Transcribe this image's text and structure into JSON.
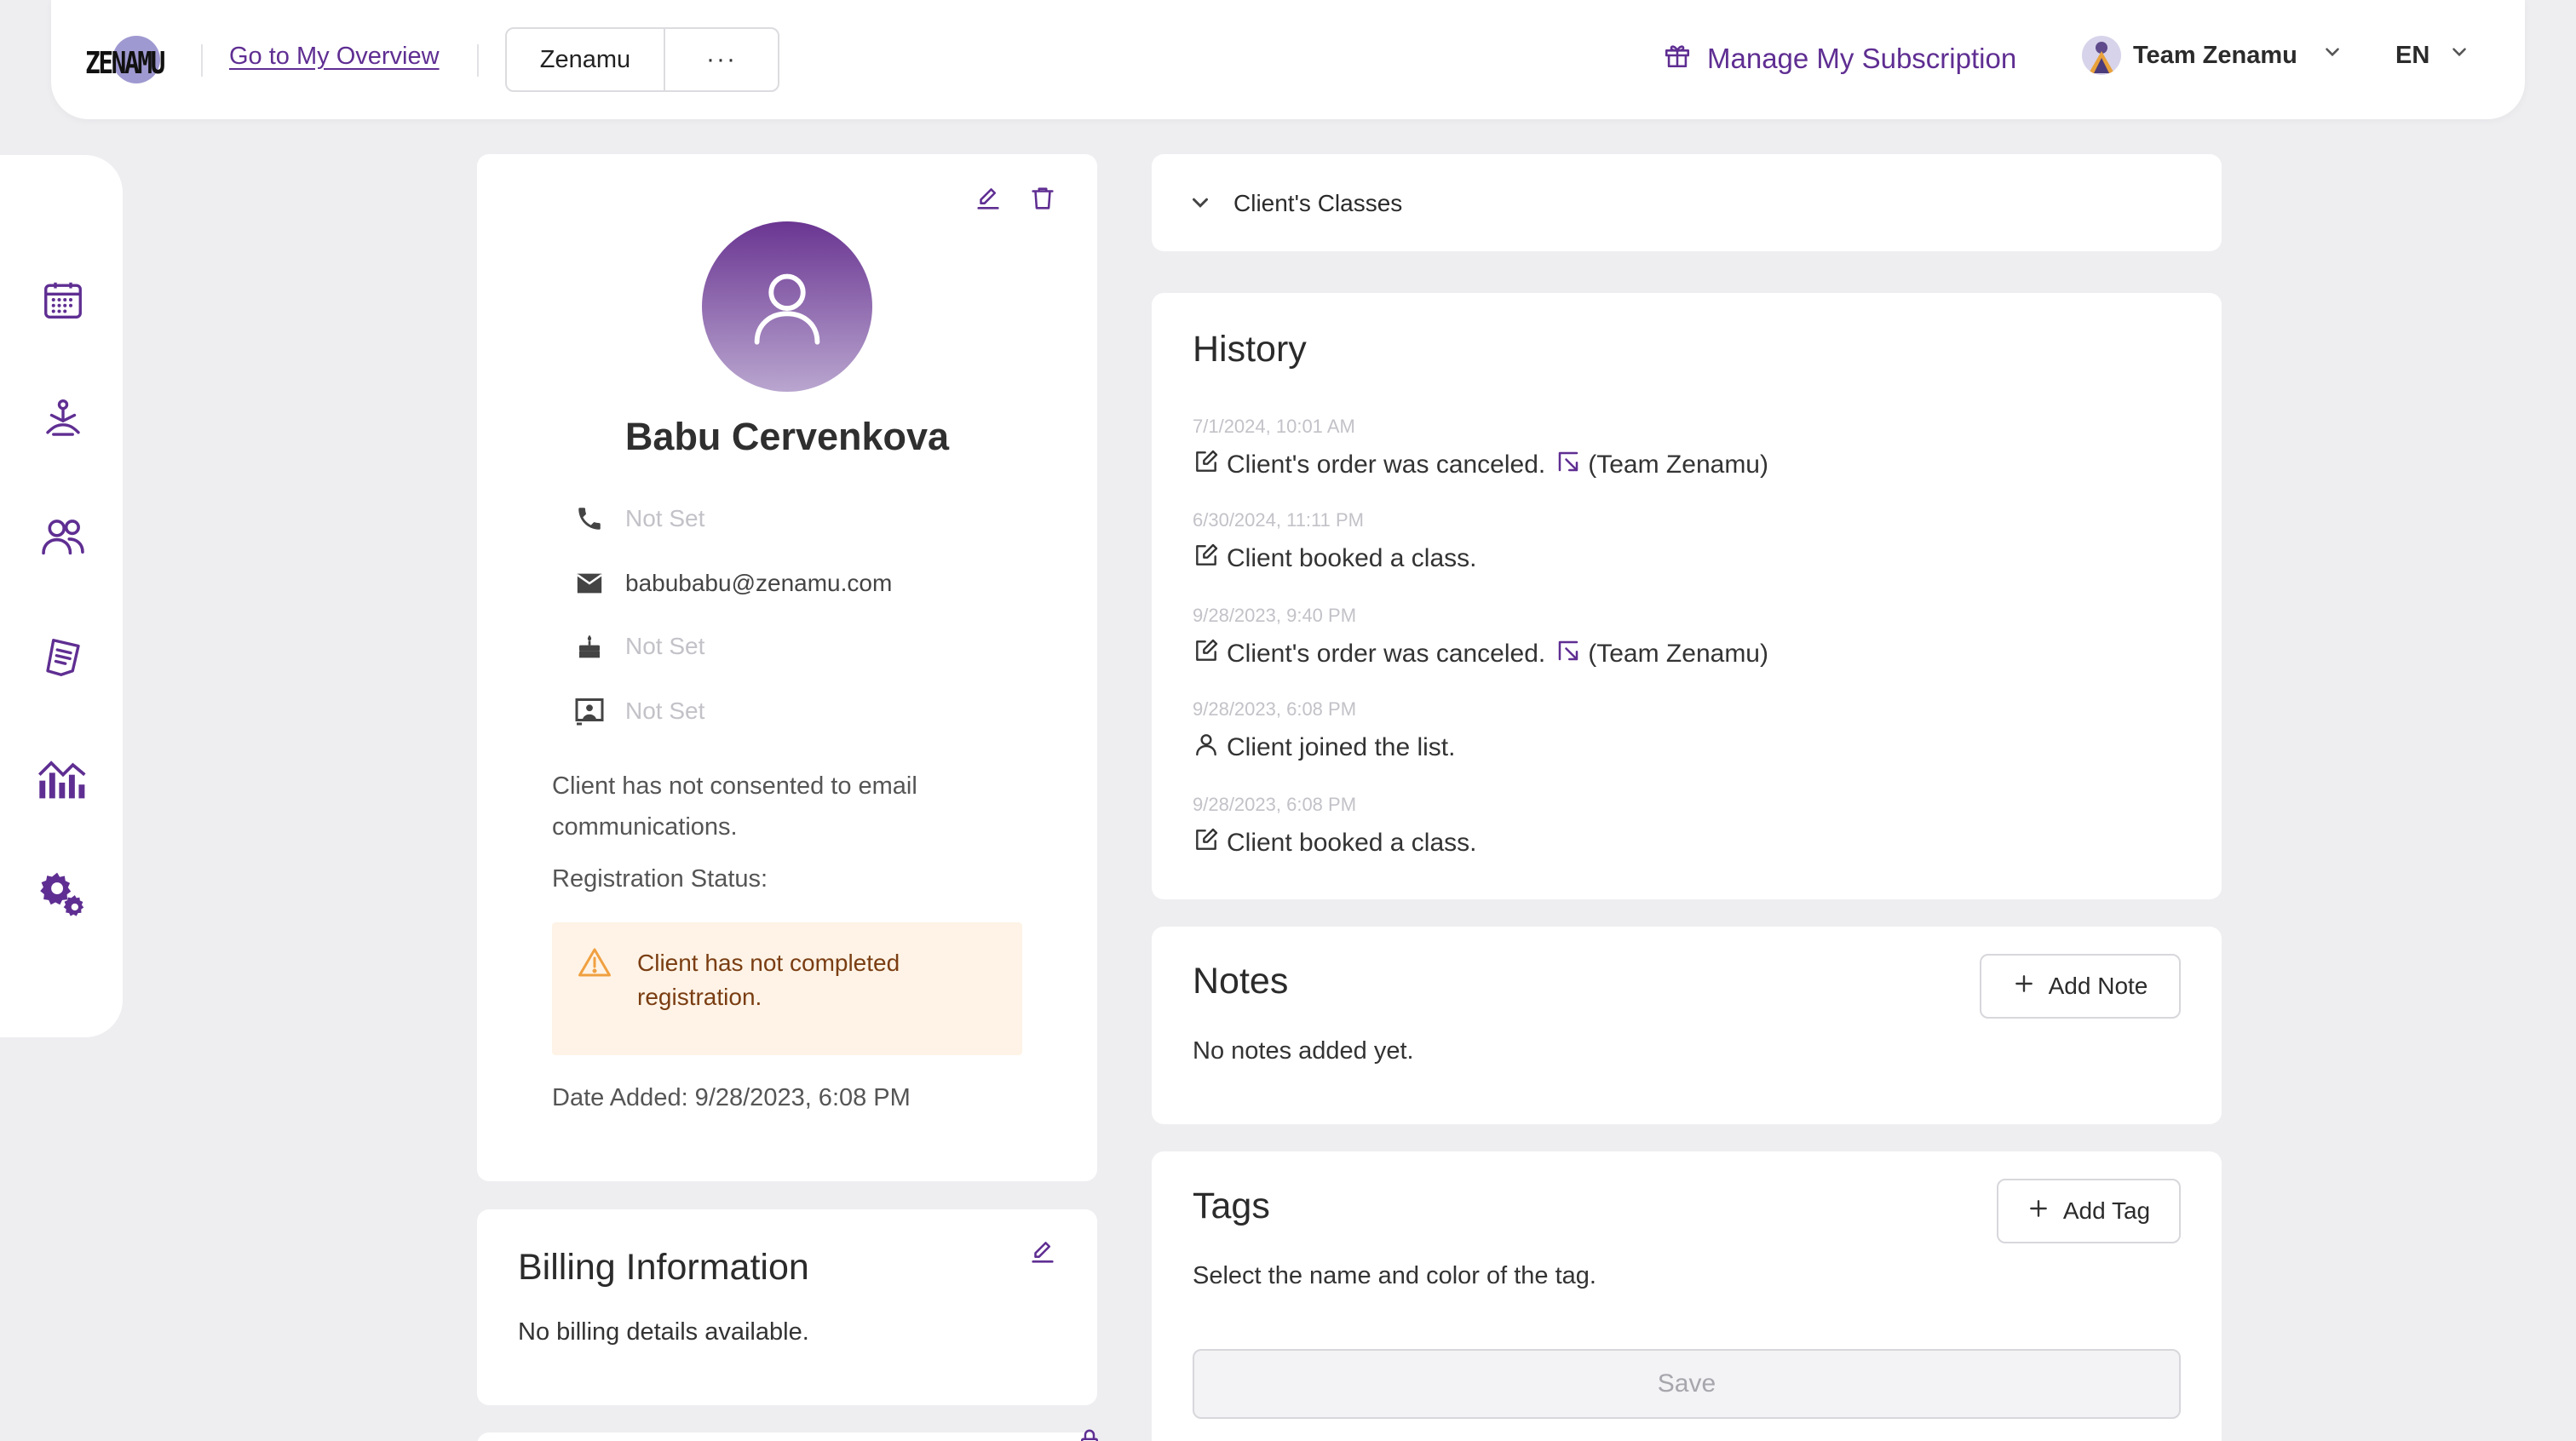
{
  "header": {
    "logo_text": "ZENAMU",
    "overview_link": "Go to My Overview",
    "studio_name": "Zenamu",
    "more_label": "···",
    "subscription_link": "Manage My Subscription",
    "team_name": "Team Zenamu",
    "language": "EN"
  },
  "sidenav": {
    "items": [
      "calendar-icon",
      "yoga-pose-icon",
      "users-icon",
      "receipt-icon",
      "analytics-icon",
      "settings-icon"
    ]
  },
  "profile": {
    "name": "Babu Cervenkova",
    "phone": "Not Set",
    "email": "babubabu@zenamu.com",
    "birthday": "Not Set",
    "id_card": "Not Set",
    "consent_text": "Client has not consented to email communications.",
    "registration_label": "Registration Status:",
    "registration_warning": "Client has not completed registration.",
    "date_added": "Date Added: 9/28/2023, 6:08 PM"
  },
  "billing": {
    "title": "Billing Information",
    "empty_text": "No billing details available."
  },
  "classes": {
    "title": "Client's Classes"
  },
  "history": {
    "title": "History",
    "entries": [
      {
        "time": "7/1/2024, 10:01 AM",
        "text": "Client's order was canceled.",
        "actor": "(Team Zenamu)",
        "icon": "edit-note-icon"
      },
      {
        "time": "6/30/2024, 11:11 PM",
        "text": "Client booked a class.",
        "actor": "",
        "icon": "edit-note-icon"
      },
      {
        "time": "9/28/2023, 9:40 PM",
        "text": "Client's order was canceled.",
        "actor": "(Team Zenamu)",
        "icon": "edit-note-icon"
      },
      {
        "time": "9/28/2023, 6:08 PM",
        "text": "Client joined the list.",
        "actor": "",
        "icon": "user-icon"
      },
      {
        "time": "9/28/2023, 6:08 PM",
        "text": "Client booked a class.",
        "actor": "",
        "icon": "edit-note-icon"
      }
    ]
  },
  "notes": {
    "title": "Notes",
    "add_label": "Add Note",
    "empty_text": "No notes added yet."
  },
  "tags": {
    "title": "Tags",
    "add_label": "Add Tag",
    "hint": "Select the name and color of the tag.",
    "save_label": "Save"
  },
  "colors": {
    "accent": "#5f2e92",
    "background": "#eeeef1",
    "warning_bg": "#fef3e6",
    "warning_icon": "#f0a040"
  }
}
